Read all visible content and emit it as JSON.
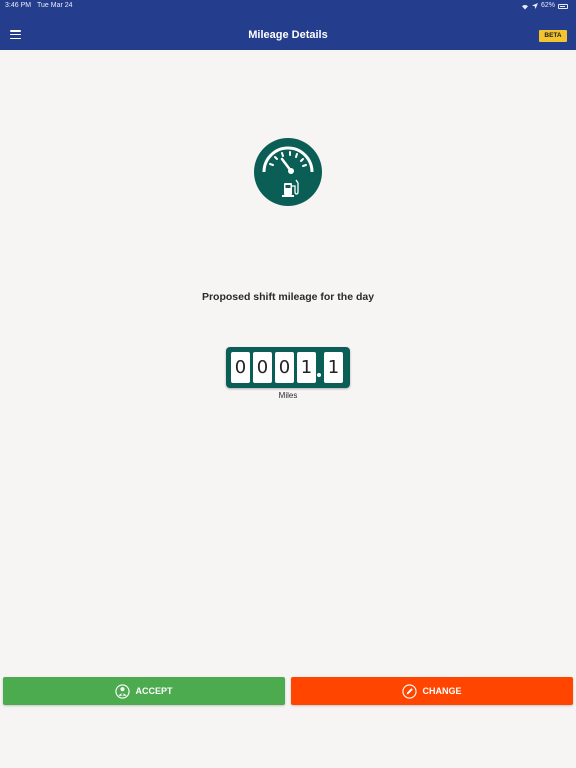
{
  "status_bar": {
    "time": "3:46 PM",
    "date": "Tue Mar 24",
    "battery": "62%"
  },
  "header": {
    "title": "Mileage Details",
    "badge": "BETA",
    "background_color": "#243d8c"
  },
  "main": {
    "icon": "fuel-gauge-icon",
    "subtitle": "Proposed shift mileage for the day",
    "odometer": {
      "digits": [
        "0",
        "0",
        "0",
        "1",
        "1"
      ],
      "value": "0001.1",
      "unit": "Miles",
      "color": "#0b5e55"
    }
  },
  "actions": {
    "accept": {
      "label": "ACCEPT",
      "icon": "driver-icon",
      "color": "#4caa4f"
    },
    "change": {
      "label": "CHANGE",
      "icon": "pencil-icon",
      "color": "#ff4500"
    }
  }
}
